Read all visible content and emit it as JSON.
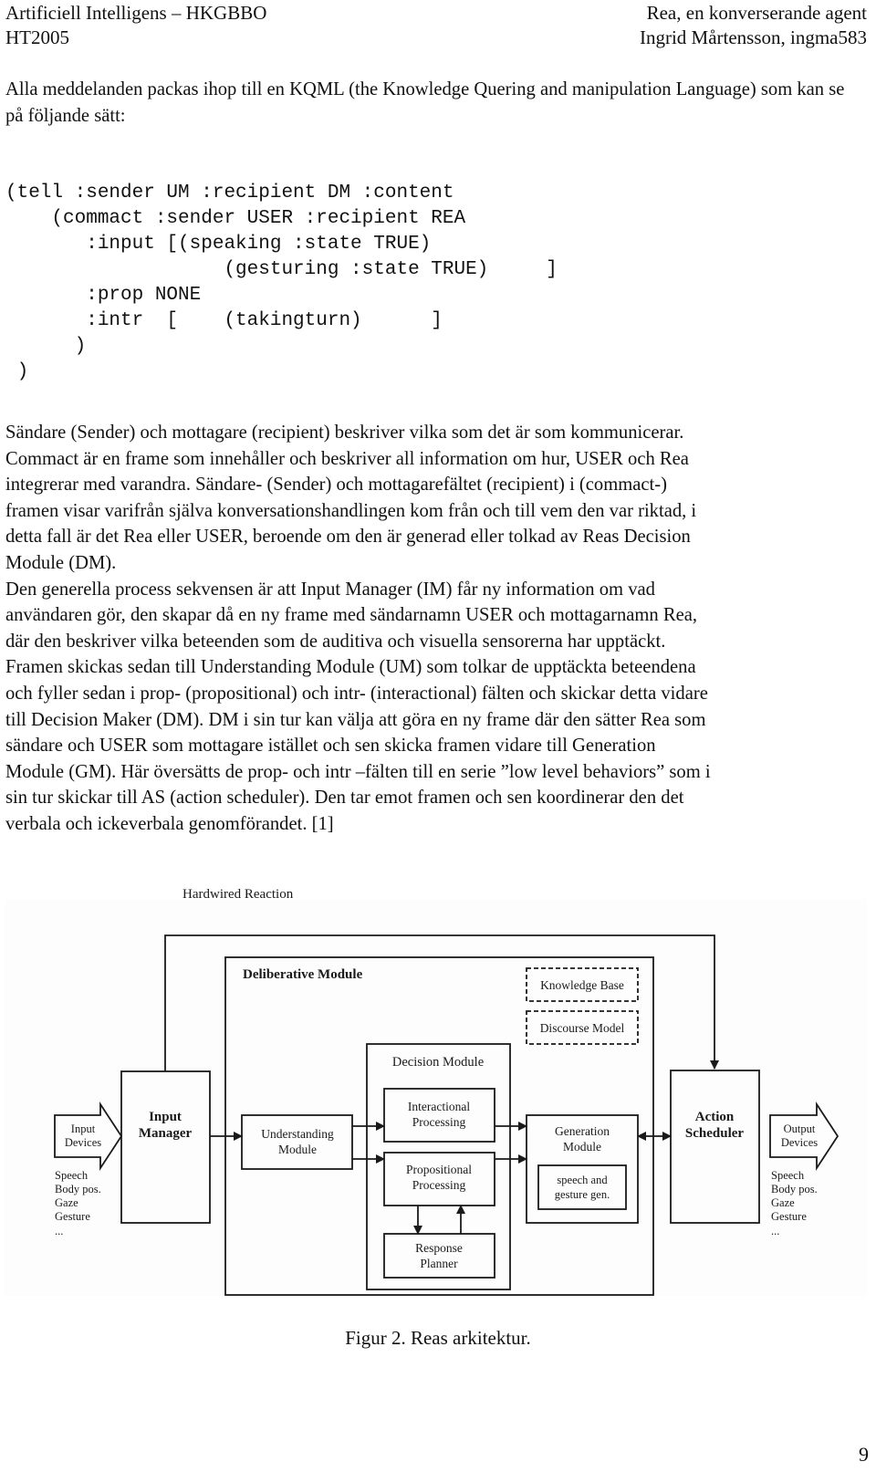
{
  "header": {
    "left_line1": "Artificiell Intelligens – HKGBBO",
    "left_line2": "HT2005",
    "right_line1": "Rea, en konverserande agent",
    "right_line2": "Ingrid Mårtensson, ingma583"
  },
  "intro": "Alla meddelanden packas ihop till en KQML (the Knowledge Quering and manipulation Language) som kan se på följande sätt:",
  "code_lines": [
    "(tell :sender UM :recipient DM :content",
    "    (commact :sender USER :recipient REA",
    "       :input [(speaking :state TRUE)",
    "                   (gesturing :state TRUE)     ]",
    "       :prop NONE",
    "       :intr  [    (takingturn)      ]",
    "      )",
    " )"
  ],
  "body_lines": [
    "Sändare (Sender) och mottagare (recipient) beskriver vilka som det är som kommunicerar.",
    "Commact är en frame som innehåller och beskriver all information om hur, USER och Rea",
    "integrerar med varandra. Sändare- (Sender) och mottagarefältet (recipient) i (commact-)",
    "framen visar varifrån själva konversationshandlingen kom från och till vem den var riktad, i",
    "detta fall är det Rea eller USER, beroende om den är generad eller tolkad av Reas Decision",
    "Module (DM).",
    "Den generella process sekvensen är att Input Manager (IM) får ny information om vad",
    "användaren gör, den skapar då en ny frame med sändarnamn USER och mottagarnamn Rea,",
    "där den beskriver vilka beteenden som de auditiva och visuella sensorerna har upptäckt.",
    "Framen skickas sedan till Understanding Module (UM) som tolkar de upptäckta beteendena",
    "och fyller sedan i prop- (propositional) och intr- (interactional) fälten och skickar detta vidare",
    "till Decision Maker (DM). DM i sin tur kan välja att göra en ny frame där den sätter Rea som",
    "sändare och USER som mottagare istället och sen skicka framen vidare till Generation",
    "Module (GM). Här översätts de prop- och intr –fälten till en serie ”low level behaviors” som i",
    "sin tur skickar till AS (action scheduler). Den tar emot framen och sen koordinerar den det",
    "verbala och ickeverbala genomförandet. [1]"
  ],
  "figure": {
    "hardwired_reaction": "Hardwired Reaction",
    "deliberative_module": "Deliberative Module",
    "knowledge_base": "Knowledge Base",
    "discourse_model": "Discourse Model",
    "decision_module": "Decision Module",
    "interactional_processing": [
      "Interactional",
      "Processing"
    ],
    "propositional_processing": [
      "Propositional",
      "Processing"
    ],
    "response_planner": [
      "Response",
      "Planner"
    ],
    "input_manager": [
      "Input",
      "Manager"
    ],
    "understanding_module": [
      "Understanding",
      "Module"
    ],
    "generation_module": [
      "Generation",
      "Module"
    ],
    "speech_gesture_gen": [
      "speech and",
      "gesture gen."
    ],
    "action_scheduler": [
      "Action",
      "Scheduler"
    ],
    "input_devices": [
      "Input",
      "Devices"
    ],
    "output_devices": [
      "Output",
      "Devices"
    ],
    "input_modalities": [
      "Speech",
      "Body pos.",
      "Gaze",
      "Gesture",
      "..."
    ],
    "output_modalities": [
      "Speech",
      "Body pos.",
      "Gaze",
      "Gesture",
      "..."
    ]
  },
  "caption": "Figur 2. Reas arkitektur.",
  "page_number": "9"
}
